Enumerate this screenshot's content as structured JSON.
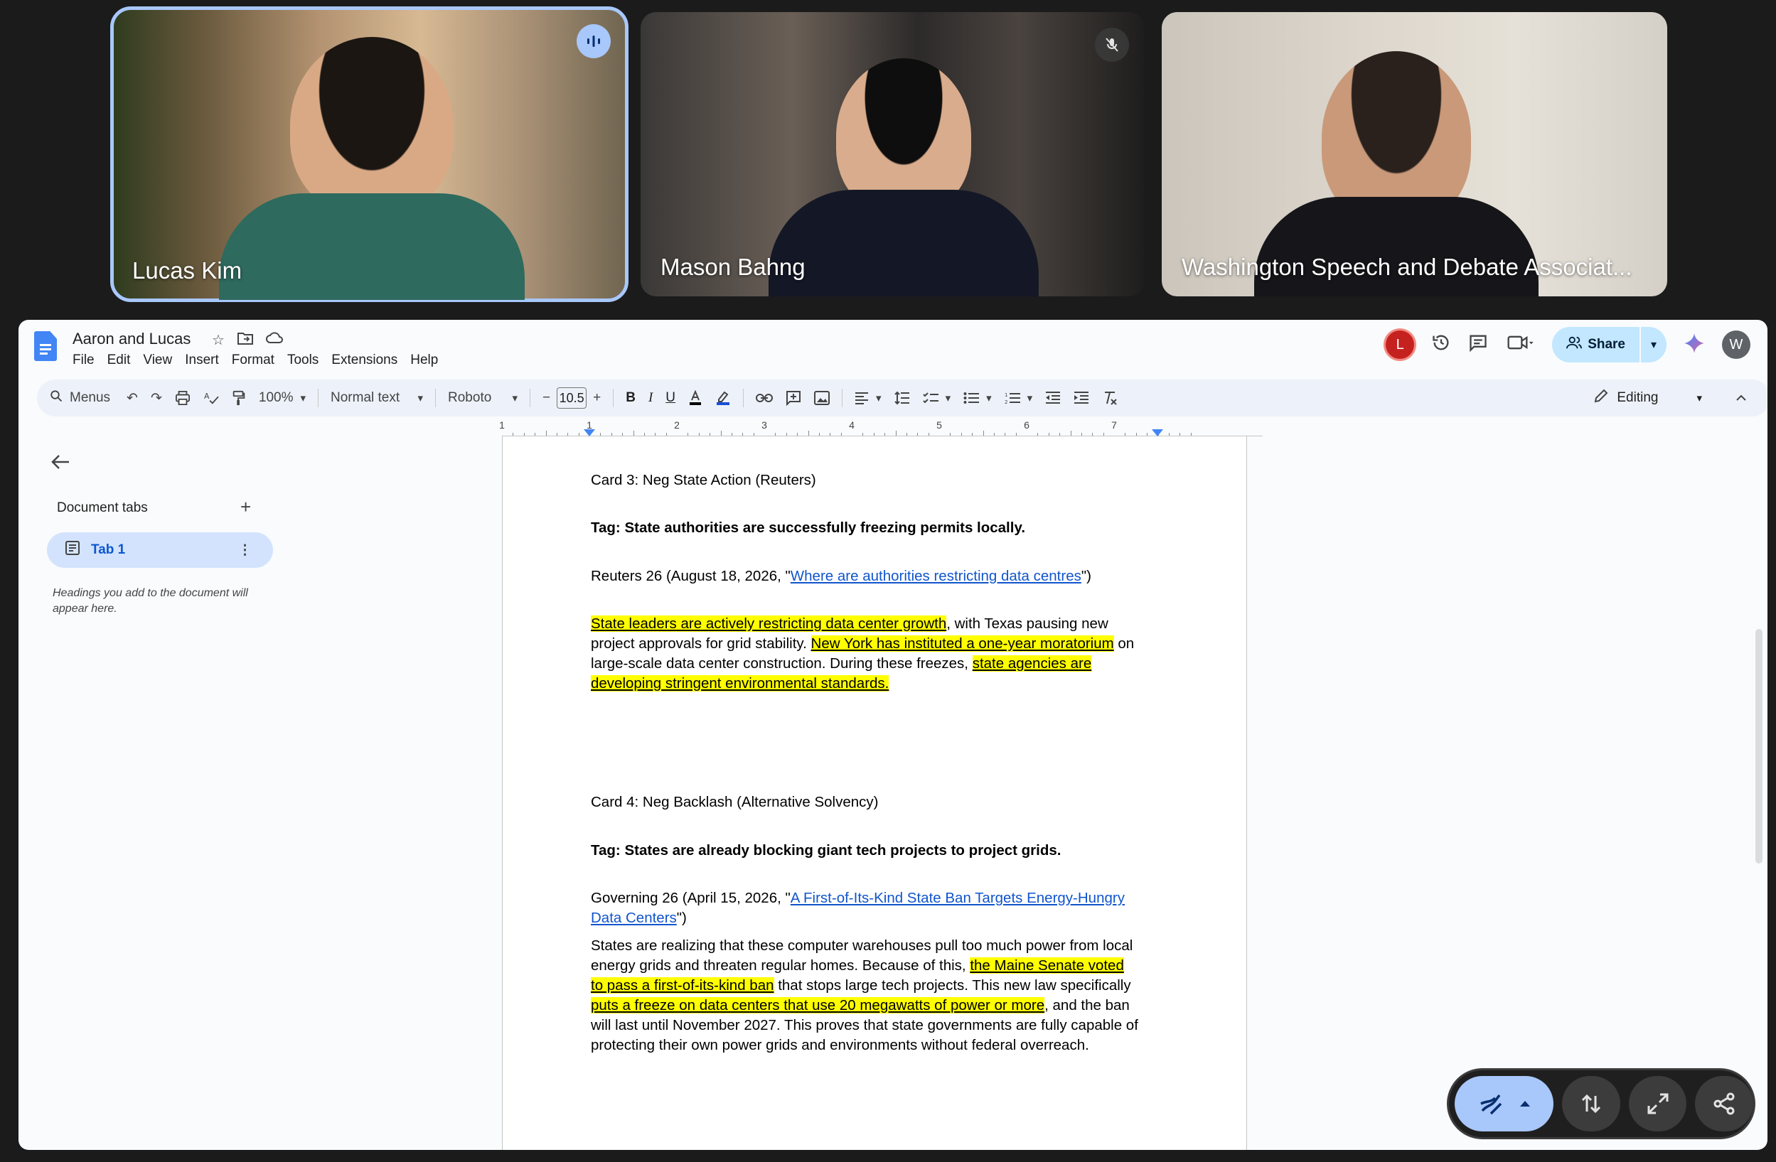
{
  "meet": {
    "participants": [
      {
        "name": "Lucas Kim",
        "status_icon": "speaking-icon"
      },
      {
        "name": "Mason Bahng",
        "status_icon": "mic-off-icon"
      },
      {
        "name": "Washington Speech and Debate Associat...",
        "status_icon": ""
      }
    ]
  },
  "doc": {
    "title": "Aaron and Lucas",
    "menu": [
      "File",
      "Edit",
      "View",
      "Insert",
      "Format",
      "Tools",
      "Extensions",
      "Help"
    ],
    "avatar_left": "L",
    "avatar_right": "W",
    "share_label": "Share",
    "toolbar": {
      "search_placeholder": "Menus",
      "zoom": "100%",
      "style": "Normal text",
      "font": "Roboto",
      "font_size": "10.5",
      "mode": "Editing"
    },
    "ruler_numbers": [
      "1",
      "1",
      "2",
      "3",
      "4",
      "5",
      "6",
      "7"
    ],
    "sidebar": {
      "title": "Document tabs",
      "tab_label": "Tab 1",
      "hint": "Headings you add to the document will appear here."
    },
    "cards": {
      "c3_title": "Card 3: Neg State Action (Reuters)",
      "c3_tag": "Tag: State authorities are successfully freezing permits locally.",
      "c3_cite_pre": "Reuters 26 (August 18, 2026, \"",
      "c3_cite_link": "Where are authorities restricting data centres",
      "c3_cite_post": "\")",
      "c3_h1": "State leaders are actively restricting data center growth",
      "c3_t1": ", with Texas pausing new project approvals for grid stability. ",
      "c3_h2": "New York has instituted a one-year moratorium",
      "c3_t2": " on large-scale data center construction. During these freezes, ",
      "c3_h3": "state agencies are developing stringent environmental standards.",
      "c4_title": "Card 4: Neg Backlash (Alternative Solvency)",
      "c4_tag": "Tag: States are already blocking giant tech projects to project grids.",
      "c4_cite_pre": "Governing 26 (April 15, 2026, \"",
      "c4_cite_link": "A First-of-Its-Kind State Ban Targets Energy-Hungry Data Centers",
      "c4_cite_post": "\")",
      "c4_t1": "States are realizing that these computer warehouses pull too much power from local energy grids and threaten regular homes. Because of this, ",
      "c4_h1": "the Maine Senate voted to pass a first-of-its-kind ban",
      "c4_t2": " that stops large tech projects. This new law specifically ",
      "c4_h2": "puts a freeze on data centers that use 20 megawatts of power or more",
      "c4_t3": ", and the ban will last until November 2027. This proves that state governments are fully capable of protecting their own power grids and environments without federal overreach."
    }
  },
  "colors": {
    "highlight": "#ffff00",
    "link": "#1155cc",
    "share_bg": "#c2e7ff",
    "avatar_left_bg": "#c5221f",
    "avatar_right_bg": "#5f6368"
  }
}
